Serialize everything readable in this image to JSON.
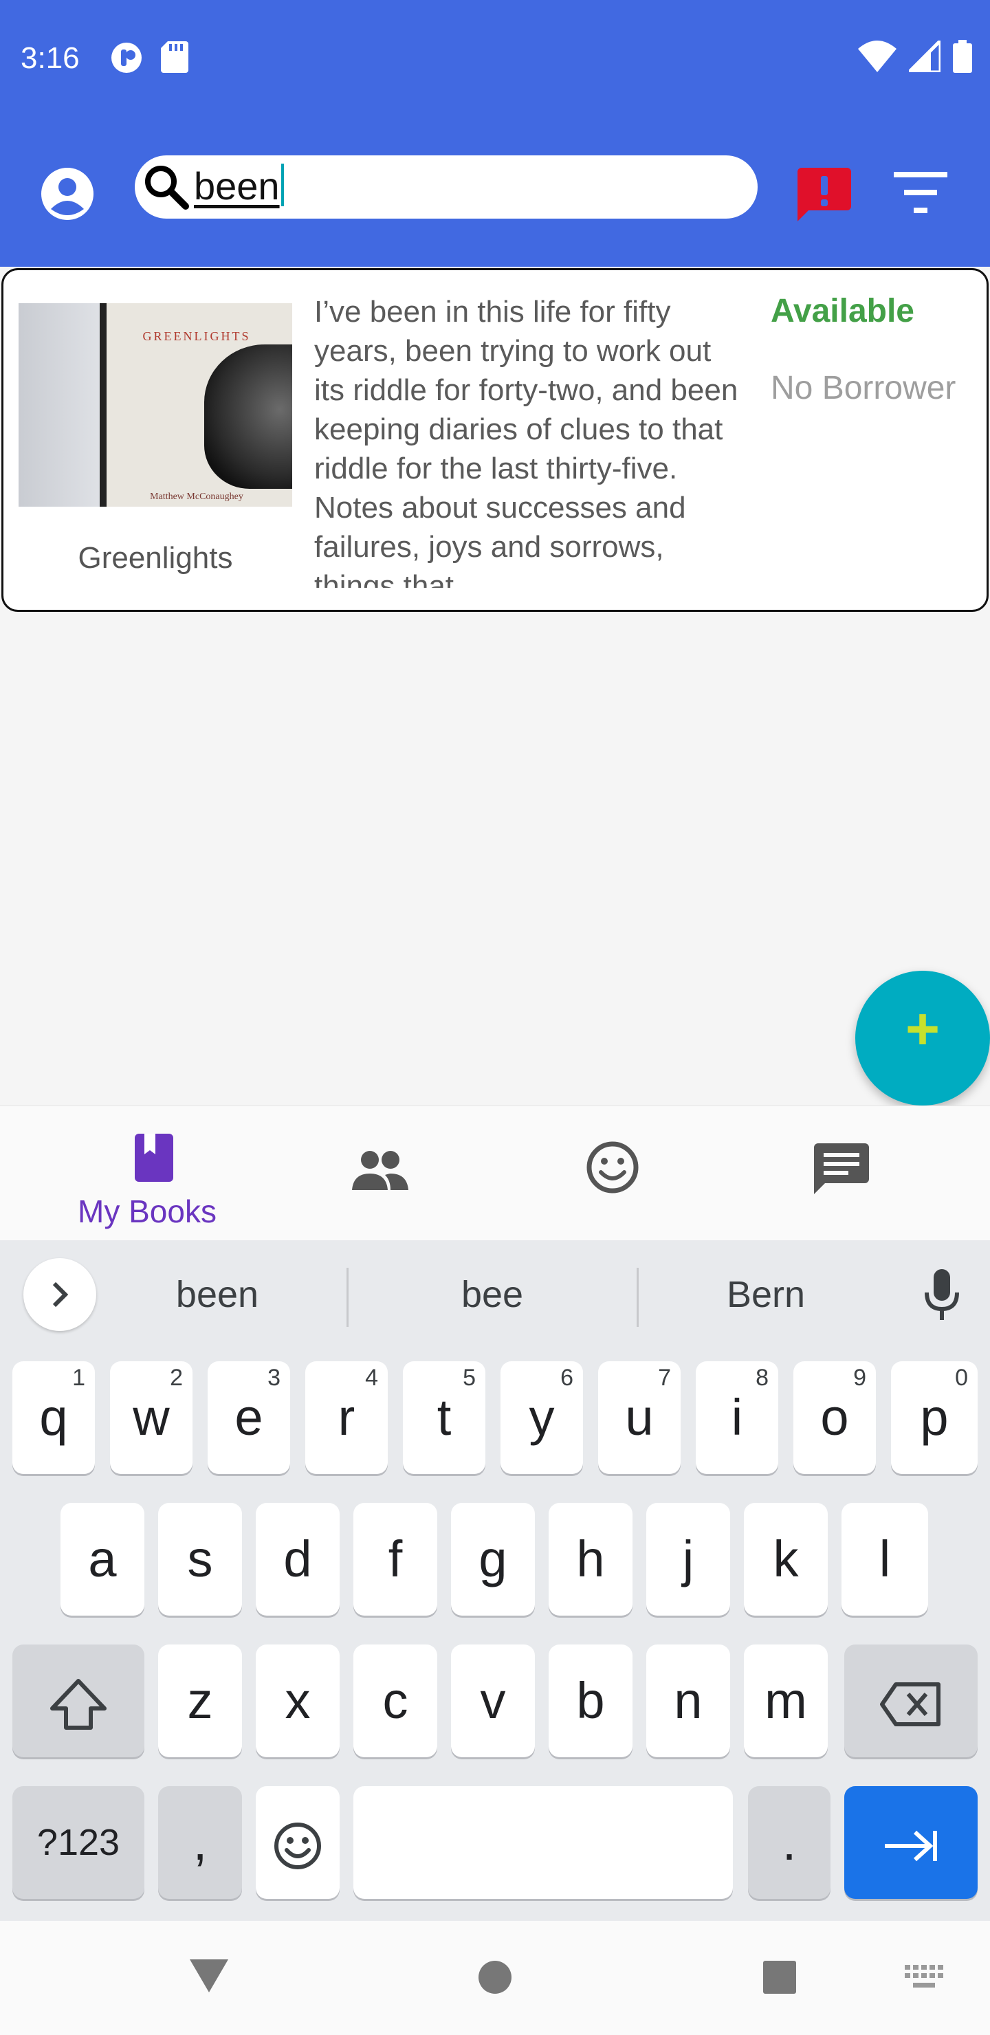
{
  "status_bar": {
    "time": "3:16"
  },
  "search": {
    "value": "been"
  },
  "book": {
    "title": "Greenlights",
    "cover_title": "GREENLIGHTS",
    "cover_author": "Matthew McConaughey",
    "description": "I’ve been in this life for fifty years, been trying to work out its riddle for forty-two, and been keeping diaries of clues to that riddle for the last thirty-five. Notes about successes and failures, joys and sorrows, things that",
    "status": "Available",
    "borrower": "No Borrower"
  },
  "fab": {
    "label": "+"
  },
  "bottom_nav": {
    "items": [
      {
        "label": "My Books",
        "icon": "book-icon",
        "active": true
      },
      {
        "label": "",
        "icon": "people-icon",
        "active": false
      },
      {
        "label": "",
        "icon": "smiley-icon",
        "active": false
      },
      {
        "label": "",
        "icon": "chat-icon",
        "active": false
      }
    ]
  },
  "keyboard": {
    "suggestions": [
      "been",
      "bee",
      "Bern"
    ],
    "row1": [
      "q",
      "w",
      "e",
      "r",
      "t",
      "y",
      "u",
      "i",
      "o",
      "p"
    ],
    "row1_hints": [
      "1",
      "2",
      "3",
      "4",
      "5",
      "6",
      "7",
      "8",
      "9",
      "0"
    ],
    "row2": [
      "a",
      "s",
      "d",
      "f",
      "g",
      "h",
      "j",
      "k",
      "l"
    ],
    "row3": [
      "z",
      "x",
      "c",
      "v",
      "b",
      "n",
      "m"
    ],
    "symbols_key": "?123",
    "comma_key": ",",
    "period_key": "."
  },
  "colors": {
    "appbar": "#4169e1",
    "accent": "#6a35c0",
    "available": "#43a047",
    "fab": "#00acc1",
    "alert": "#e0102a"
  }
}
